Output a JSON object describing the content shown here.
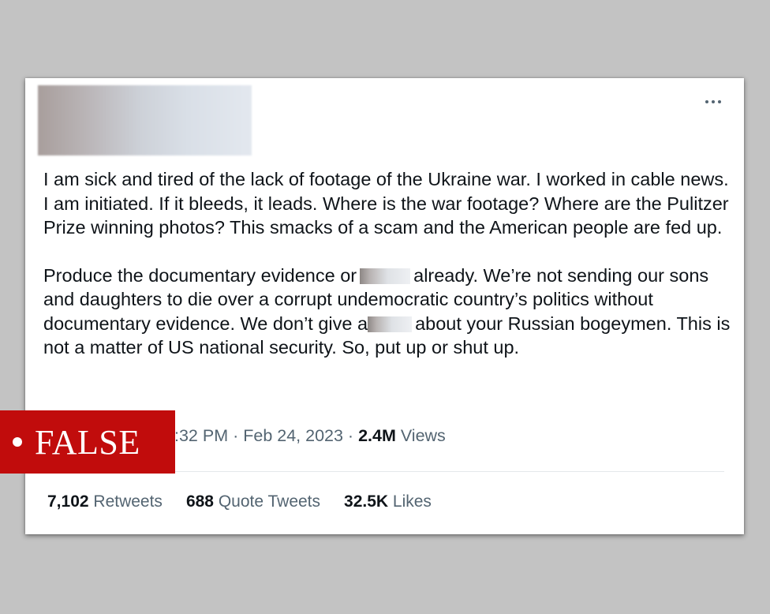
{
  "tweet": {
    "more_icon": "more-dots-icon",
    "paragraph_1": "I am sick and tired of the lack of footage of the Ukraine war. I worked in cable news. I am initiated. If it bleeds, it leads. Where is the war footage? Where are the Pulitzer Prize winning photos? This smacks of a scam and the American people are fed up.",
    "paragraph_2": {
      "part_1": "Produce the documentary evidence or",
      "part_2": "already. We’re not sending our sons and daughters to die over a corrupt undemocratic country’s politics without documentary evidence.  We don’t give a",
      "part_3": "about your Russian bogeymen. This is not a matter of US national security. So, put up or shut up."
    },
    "meta": {
      "time": ":32 PM",
      "sep_1": " · ",
      "date": "Feb 24, 2023",
      "sep_2": " · ",
      "views_count": "2.4M",
      "views_label": " Views"
    },
    "stats": {
      "retweets_count": "7,102",
      "retweets_label": " Retweets",
      "quotes_count": "688",
      "quotes_label": " Quote Tweets",
      "likes_count": "32.5K",
      "likes_label": " Likes"
    }
  },
  "fact_check_label": {
    "text": "FALSE",
    "color": "#c10c0c"
  }
}
